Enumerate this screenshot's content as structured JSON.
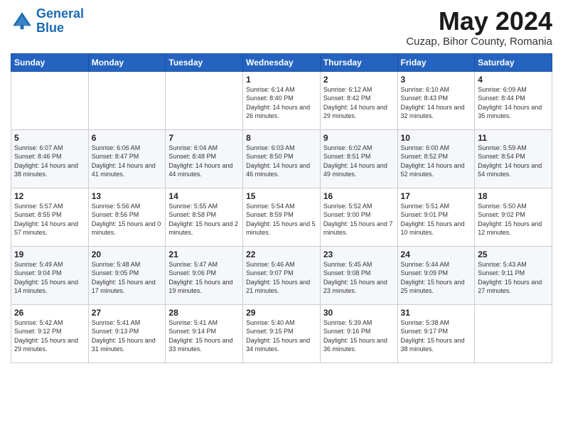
{
  "header": {
    "logo_line1": "General",
    "logo_line2": "Blue",
    "month_year": "May 2024",
    "location": "Cuzap, Bihor County, Romania"
  },
  "weekdays": [
    "Sunday",
    "Monday",
    "Tuesday",
    "Wednesday",
    "Thursday",
    "Friday",
    "Saturday"
  ],
  "weeks": [
    [
      {
        "day": "",
        "sunrise": "",
        "sunset": "",
        "daylight": ""
      },
      {
        "day": "",
        "sunrise": "",
        "sunset": "",
        "daylight": ""
      },
      {
        "day": "",
        "sunrise": "",
        "sunset": "",
        "daylight": ""
      },
      {
        "day": "1",
        "sunrise": "Sunrise: 6:14 AM",
        "sunset": "Sunset: 8:40 PM",
        "daylight": "Daylight: 14 hours and 26 minutes."
      },
      {
        "day": "2",
        "sunrise": "Sunrise: 6:12 AM",
        "sunset": "Sunset: 8:42 PM",
        "daylight": "Daylight: 14 hours and 29 minutes."
      },
      {
        "day": "3",
        "sunrise": "Sunrise: 6:10 AM",
        "sunset": "Sunset: 8:43 PM",
        "daylight": "Daylight: 14 hours and 32 minutes."
      },
      {
        "day": "4",
        "sunrise": "Sunrise: 6:09 AM",
        "sunset": "Sunset: 8:44 PM",
        "daylight": "Daylight: 14 hours and 35 minutes."
      }
    ],
    [
      {
        "day": "5",
        "sunrise": "Sunrise: 6:07 AM",
        "sunset": "Sunset: 8:46 PM",
        "daylight": "Daylight: 14 hours and 38 minutes."
      },
      {
        "day": "6",
        "sunrise": "Sunrise: 6:06 AM",
        "sunset": "Sunset: 8:47 PM",
        "daylight": "Daylight: 14 hours and 41 minutes."
      },
      {
        "day": "7",
        "sunrise": "Sunrise: 6:04 AM",
        "sunset": "Sunset: 8:48 PM",
        "daylight": "Daylight: 14 hours and 44 minutes."
      },
      {
        "day": "8",
        "sunrise": "Sunrise: 6:03 AM",
        "sunset": "Sunset: 8:50 PM",
        "daylight": "Daylight: 14 hours and 46 minutes."
      },
      {
        "day": "9",
        "sunrise": "Sunrise: 6:02 AM",
        "sunset": "Sunset: 8:51 PM",
        "daylight": "Daylight: 14 hours and 49 minutes."
      },
      {
        "day": "10",
        "sunrise": "Sunrise: 6:00 AM",
        "sunset": "Sunset: 8:52 PM",
        "daylight": "Daylight: 14 hours and 52 minutes."
      },
      {
        "day": "11",
        "sunrise": "Sunrise: 5:59 AM",
        "sunset": "Sunset: 8:54 PM",
        "daylight": "Daylight: 14 hours and 54 minutes."
      }
    ],
    [
      {
        "day": "12",
        "sunrise": "Sunrise: 5:57 AM",
        "sunset": "Sunset: 8:55 PM",
        "daylight": "Daylight: 14 hours and 57 minutes."
      },
      {
        "day": "13",
        "sunrise": "Sunrise: 5:56 AM",
        "sunset": "Sunset: 8:56 PM",
        "daylight": "Daylight: 15 hours and 0 minutes."
      },
      {
        "day": "14",
        "sunrise": "Sunrise: 5:55 AM",
        "sunset": "Sunset: 8:58 PM",
        "daylight": "Daylight: 15 hours and 2 minutes."
      },
      {
        "day": "15",
        "sunrise": "Sunrise: 5:54 AM",
        "sunset": "Sunset: 8:59 PM",
        "daylight": "Daylight: 15 hours and 5 minutes."
      },
      {
        "day": "16",
        "sunrise": "Sunrise: 5:52 AM",
        "sunset": "Sunset: 9:00 PM",
        "daylight": "Daylight: 15 hours and 7 minutes."
      },
      {
        "day": "17",
        "sunrise": "Sunrise: 5:51 AM",
        "sunset": "Sunset: 9:01 PM",
        "daylight": "Daylight: 15 hours and 10 minutes."
      },
      {
        "day": "18",
        "sunrise": "Sunrise: 5:50 AM",
        "sunset": "Sunset: 9:02 PM",
        "daylight": "Daylight: 15 hours and 12 minutes."
      }
    ],
    [
      {
        "day": "19",
        "sunrise": "Sunrise: 5:49 AM",
        "sunset": "Sunset: 9:04 PM",
        "daylight": "Daylight: 15 hours and 14 minutes."
      },
      {
        "day": "20",
        "sunrise": "Sunrise: 5:48 AM",
        "sunset": "Sunset: 9:05 PM",
        "daylight": "Daylight: 15 hours and 17 minutes."
      },
      {
        "day": "21",
        "sunrise": "Sunrise: 5:47 AM",
        "sunset": "Sunset: 9:06 PM",
        "daylight": "Daylight: 15 hours and 19 minutes."
      },
      {
        "day": "22",
        "sunrise": "Sunrise: 5:46 AM",
        "sunset": "Sunset: 9:07 PM",
        "daylight": "Daylight: 15 hours and 21 minutes."
      },
      {
        "day": "23",
        "sunrise": "Sunrise: 5:45 AM",
        "sunset": "Sunset: 9:08 PM",
        "daylight": "Daylight: 15 hours and 23 minutes."
      },
      {
        "day": "24",
        "sunrise": "Sunrise: 5:44 AM",
        "sunset": "Sunset: 9:09 PM",
        "daylight": "Daylight: 15 hours and 25 minutes."
      },
      {
        "day": "25",
        "sunrise": "Sunrise: 5:43 AM",
        "sunset": "Sunset: 9:11 PM",
        "daylight": "Daylight: 15 hours and 27 minutes."
      }
    ],
    [
      {
        "day": "26",
        "sunrise": "Sunrise: 5:42 AM",
        "sunset": "Sunset: 9:12 PM",
        "daylight": "Daylight: 15 hours and 29 minutes."
      },
      {
        "day": "27",
        "sunrise": "Sunrise: 5:41 AM",
        "sunset": "Sunset: 9:13 PM",
        "daylight": "Daylight: 15 hours and 31 minutes."
      },
      {
        "day": "28",
        "sunrise": "Sunrise: 5:41 AM",
        "sunset": "Sunset: 9:14 PM",
        "daylight": "Daylight: 15 hours and 33 minutes."
      },
      {
        "day": "29",
        "sunrise": "Sunrise: 5:40 AM",
        "sunset": "Sunset: 9:15 PM",
        "daylight": "Daylight: 15 hours and 34 minutes."
      },
      {
        "day": "30",
        "sunrise": "Sunrise: 5:39 AM",
        "sunset": "Sunset: 9:16 PM",
        "daylight": "Daylight: 15 hours and 36 minutes."
      },
      {
        "day": "31",
        "sunrise": "Sunrise: 5:38 AM",
        "sunset": "Sunset: 9:17 PM",
        "daylight": "Daylight: 15 hours and 38 minutes."
      },
      {
        "day": "",
        "sunrise": "",
        "sunset": "",
        "daylight": ""
      }
    ]
  ]
}
